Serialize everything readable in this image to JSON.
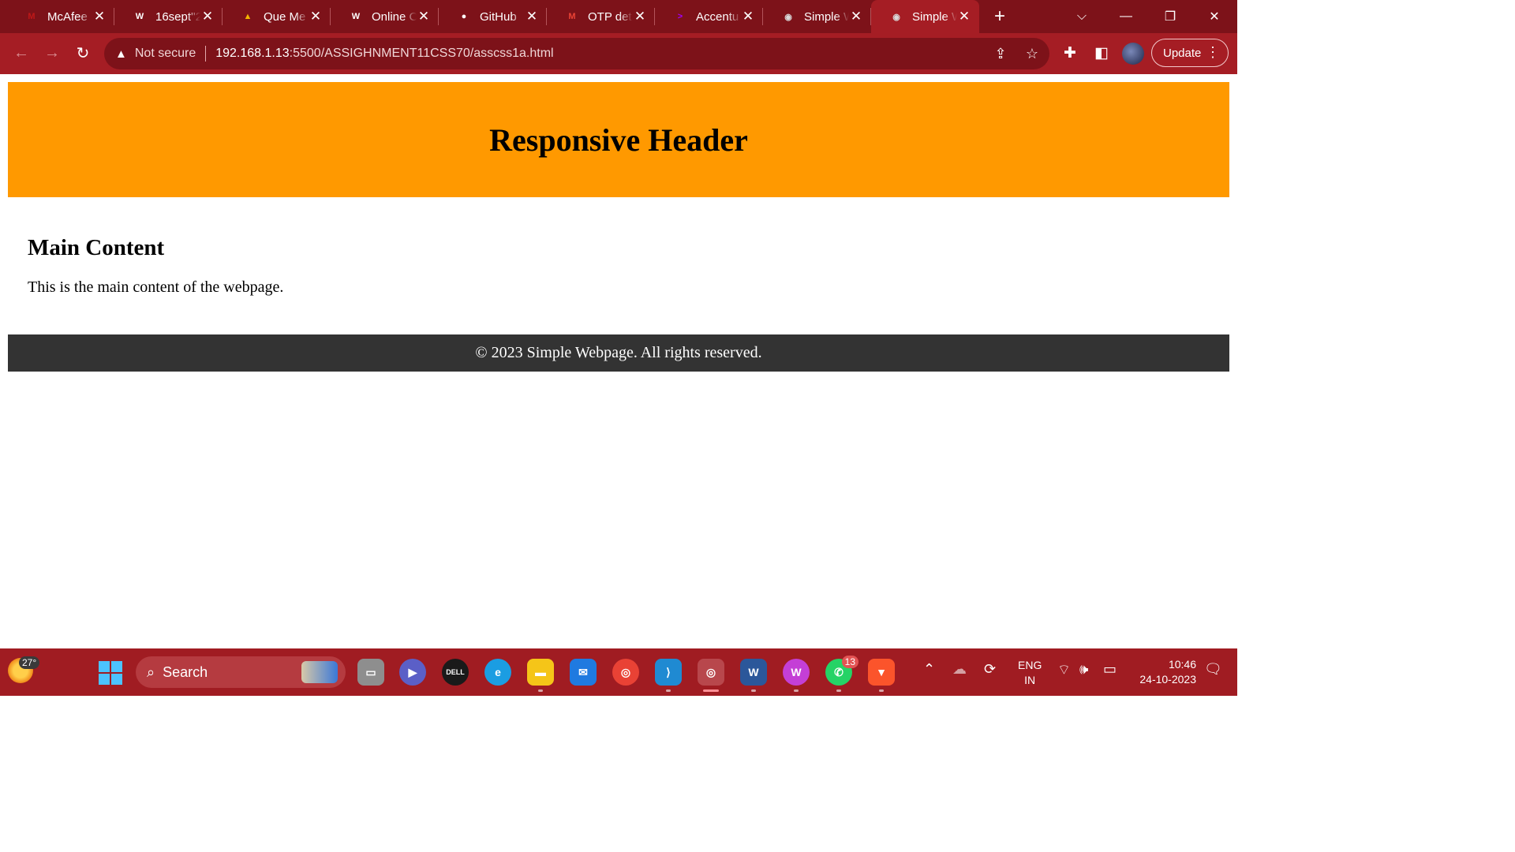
{
  "browser": {
    "tabs": [
      {
        "title": "McAfee",
        "icon": "mcafee-icon",
        "color": "#c01818",
        "glyph": "M"
      },
      {
        "title": "16sept''2",
        "icon": "wordpress-icon",
        "color": "#ffffff",
        "glyph": "W"
      },
      {
        "title": "Que Me",
        "icon": "google-drive-icon",
        "color": "#f4b400",
        "glyph": "▲"
      },
      {
        "title": "Online C",
        "icon": "wordpress-icon",
        "color": "#ffffff",
        "glyph": "W"
      },
      {
        "title": "GitHub",
        "icon": "github-icon",
        "color": "#ffffff",
        "glyph": "●"
      },
      {
        "title": "OTP det",
        "icon": "gmail-icon",
        "color": "#ea4335",
        "glyph": "M"
      },
      {
        "title": "Accentu",
        "icon": "accenture-icon",
        "color": "#a100ff",
        "glyph": ">"
      },
      {
        "title": "Simple W",
        "icon": "globe-icon",
        "color": "#d9d9d9",
        "glyph": "◉"
      },
      {
        "title": "Simple W",
        "icon": "globe-icon",
        "color": "#d9d9d9",
        "glyph": "◉",
        "active": true
      }
    ],
    "address": {
      "security_label": "Not secure",
      "host": "192.168.1.13",
      "path": ":5500/ASSIGHNMENT11CSS70/asscss1a.html"
    },
    "update_label": "Update"
  },
  "page": {
    "header_title": "Responsive Header",
    "main_heading": "Main Content",
    "main_text": "This is the main content of the webpage.",
    "footer_text": "© 2023 Simple Webpage. All rights reserved.",
    "colors": {
      "header_bg": "#ff9900",
      "footer_bg": "#333333"
    }
  },
  "taskbar": {
    "weather_temp": "27°",
    "search_placeholder": "Search",
    "whatsapp_badge": "13",
    "lang_line1": "ENG",
    "lang_line2": "IN",
    "time": "10:46",
    "date": "24-10-2023",
    "accent": "#a01c22"
  }
}
